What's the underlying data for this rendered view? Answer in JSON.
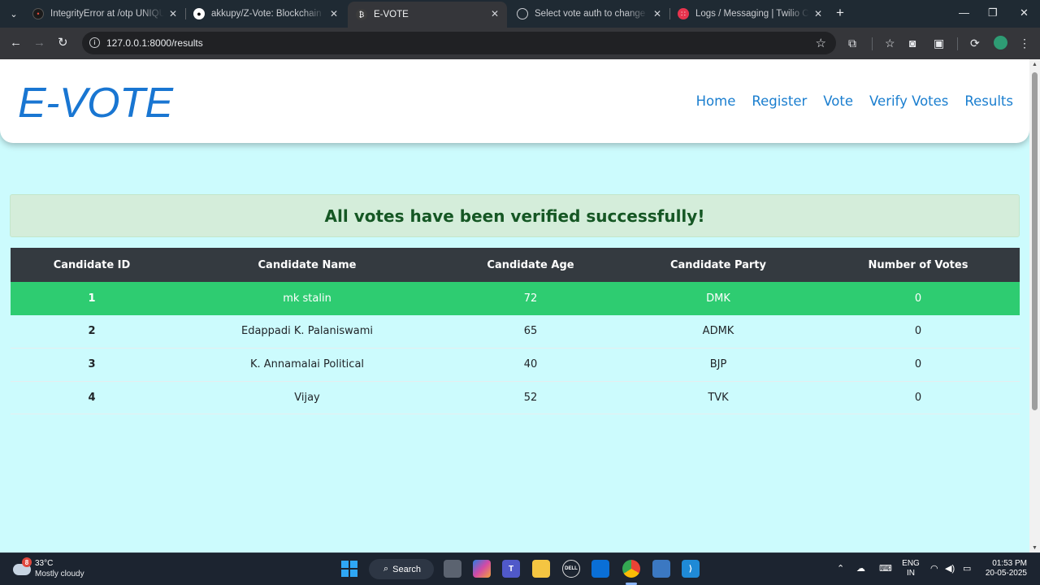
{
  "browser": {
    "tabs": [
      {
        "title": "IntegrityError at /otp UNIQUE c",
        "active": false
      },
      {
        "title": "akkupy/Z-Vote: Blockchain Base",
        "active": false
      },
      {
        "title": "E-VOTE",
        "active": true
      },
      {
        "title": "Select vote auth to change | Dj",
        "active": false
      },
      {
        "title": "Logs / Messaging | Twilio Cons",
        "active": false
      }
    ],
    "url": "127.0.0.1:8000/results"
  },
  "site": {
    "logo": "E-VOTE",
    "nav": [
      "Home",
      "Register",
      "Vote",
      "Verify Votes",
      "Results"
    ]
  },
  "alert": "All votes have been verified successfully!",
  "table": {
    "headers": [
      "Candidate ID",
      "Candidate Name",
      "Candidate Age",
      "Candidate Party",
      "Number of Votes"
    ],
    "rows": [
      {
        "id": "1",
        "name": "mk stalin",
        "age": "72",
        "party": "DMK",
        "votes": "0"
      },
      {
        "id": "2",
        "name": "Edappadi K. Palaniswami",
        "age": "65",
        "party": "ADMK",
        "votes": "0"
      },
      {
        "id": "3",
        "name": "K. Annamalai Political",
        "age": "40",
        "party": "BJP",
        "votes": "0"
      },
      {
        "id": "4",
        "name": "Vijay",
        "age": "52",
        "party": "TVK",
        "votes": "0"
      }
    ],
    "highlight_color": "#2ecc71"
  },
  "taskbar": {
    "weather_temp": "33°C",
    "weather_cond": "Mostly cloudy",
    "weather_badge": "8",
    "search": "Search",
    "lang_line1": "ENG",
    "lang_line2": "IN",
    "time": "01:53 PM",
    "date": "20-05-2025"
  }
}
